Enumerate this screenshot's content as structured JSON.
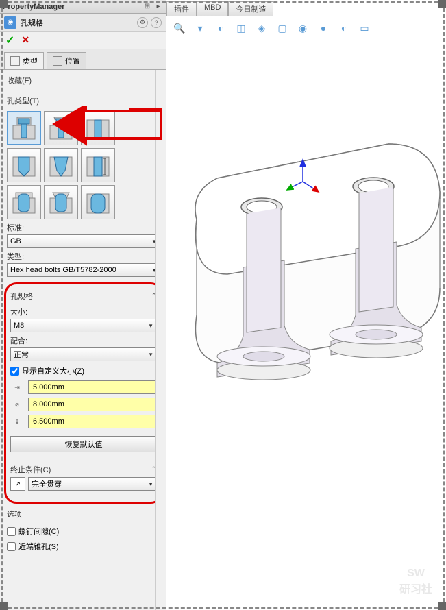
{
  "header": {
    "title": "PropertyManager"
  },
  "feature": {
    "title": "孔规格"
  },
  "tabs": {
    "type": "类型",
    "position": "位置"
  },
  "top_tabs": [
    "插件",
    "MBD",
    "今日制造"
  ],
  "sections": {
    "favorites": "收藏(F)",
    "hole_type": "孔类型(T)",
    "std_label": "标准:",
    "std_value": "GB",
    "type_label": "类型:",
    "type_value": "Hex head bolts GB/T5782-2000",
    "hole_spec": "孔规格",
    "size_label": "大小:",
    "size_value": "M8",
    "fit_label": "配合:",
    "fit_value": "正常",
    "custom_size": "显示自定义大小(Z)",
    "dim1": "5.000mm",
    "dim2": "8.000mm",
    "dim3": "6.500mm",
    "restore": "恢复默认值",
    "end_cond": "终止条件(C)",
    "end_value": "完全贯穿",
    "options": "选项",
    "opt1": "螺钉间隙(C)",
    "opt2": "近端锥孔(S)"
  },
  "watermark": {
    "l1": "SW",
    "l2": "研习社"
  }
}
